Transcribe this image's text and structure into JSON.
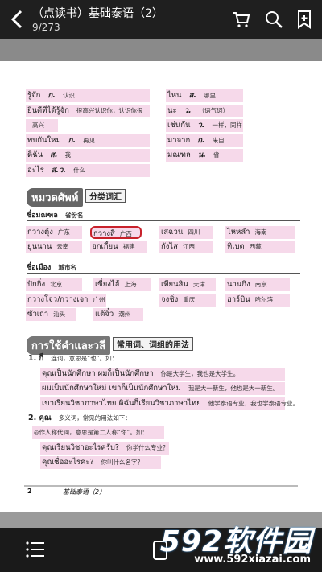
{
  "header": {
    "title": "（点读书）基础泰语（2）",
    "page_info": "9/273"
  },
  "vocab_left": [
    {
      "th": "รู้จัก",
      "pos": "ก.",
      "cn": "认识"
    },
    {
      "th": "ยินดีที่ได้รู้จัก",
      "pos": "",
      "cn": "很高兴认识你，认识你很"
    },
    {
      "th": "",
      "pos": "",
      "cn": "高兴"
    },
    {
      "th": "พบกันใหม่",
      "pos": "ก.",
      "cn": "再见"
    },
    {
      "th": "ดิฉัน",
      "pos": "ส.",
      "cn": "我"
    },
    {
      "th": "อะไร",
      "pos": "ส.ว.",
      "cn": "什么"
    }
  ],
  "vocab_right": [
    {
      "th": "ไหน",
      "pos": "ส.",
      "cn": "哪里"
    },
    {
      "th": "นะ",
      "pos": "ว.",
      "cn": "（语气词）"
    },
    {
      "th": "เช่นกัน",
      "pos": "ว.",
      "cn": "一样，同样"
    },
    {
      "th": "มาจาก",
      "pos": "ก.",
      "cn": "来自"
    },
    {
      "th": "มณฑล",
      "pos": "น.",
      "cn": "省"
    }
  ],
  "section1": {
    "th": "หมวดศัพท์",
    "cn": "分类词汇"
  },
  "provinces_head": {
    "th": "ชื่อมณฑล",
    "cn": "省份名"
  },
  "provinces": [
    {
      "th": "กวางตุ้ง",
      "cn": "广东"
    },
    {
      "th": "กวางสี",
      "cn": "广西"
    },
    {
      "th": "เสฉวน",
      "cn": "四川"
    },
    {
      "th": "ไหหลำ",
      "cn": "海南"
    },
    {
      "th": "ยูนนาน",
      "cn": "云南"
    },
    {
      "th": "ฮกเกี้ยน",
      "cn": "福建"
    },
    {
      "th": "กังไส",
      "cn": "江西"
    },
    {
      "th": "ทิเบต",
      "cn": "西藏"
    }
  ],
  "cities_head": {
    "th": "ชื่อเมือง",
    "cn": "城市名"
  },
  "cities": [
    {
      "th": "ปักกิ่ง",
      "cn": "北京"
    },
    {
      "th": "เซี่ยงไฮ้",
      "cn": "上海"
    },
    {
      "th": "เทียนสิน",
      "cn": "天津"
    },
    {
      "th": "นานกิง",
      "cn": "南京"
    },
    {
      "th": "กวางโจว/กวางเจา",
      "cn": "广州"
    },
    {
      "th": "จงชิ่ง",
      "cn": "重庆"
    },
    {
      "th": "ฮาร์บิน",
      "cn": "哈尔滨"
    },
    {
      "th": "ซัวเถา",
      "cn": "汕头"
    },
    {
      "th": "แต้จิ๋ว",
      "cn": "潮州"
    }
  ],
  "section2": {
    "th": "การใช้คำและวลี",
    "cn": "常用词、词组的用法"
  },
  "usage": {
    "item1": "1. ก็",
    "item1_desc": "连词，意思是“也”。如：",
    "ex1": {
      "th": "คุณเป็นนักศึกษา ผมก็เป็นนักศึกษา",
      "cn": "你是大学生，我也是大学生。"
    },
    "ex2": {
      "th": "ผมเป็นนักศึกษาใหม่ เขาก็เป็นนักศึกษาใหม่",
      "cn": "我是大一新生，他也是大一新生。"
    },
    "ex3": {
      "th": "เขาเรียนวิชาภาษาไทย ดิฉันก็เรียนวิชาภาษาไทย",
      "cn": "他学泰语专业，我也学泰语专业。"
    },
    "item2": "2. คุณ",
    "item2_desc": "多义词，常见的用法如下：",
    "item2_sub": "◎作人称代词，意思是第二人称“你”。如：",
    "ex4": {
      "th": "คุณเรียนวิชาอะไรครับ?",
      "cn": "你学什么专业？"
    },
    "ex5": {
      "th": "คุณชื่ออะไรคะ?",
      "cn": "你叫什么名字？"
    }
  },
  "footer": {
    "page_num": "2",
    "book": "基础泰语（2）"
  },
  "watermark": {
    "brand": "592软件园",
    "url": "www.592xiazai.com"
  }
}
